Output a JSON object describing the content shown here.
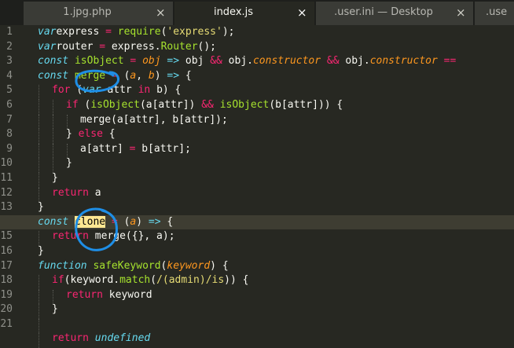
{
  "tabs": [
    {
      "label": "1.jpg.php",
      "close": "×",
      "active": false
    },
    {
      "label": "index.js",
      "close": "×",
      "active": true
    },
    {
      "label": ".user.ini — Desktop",
      "close": "×",
      "active": false
    },
    {
      "label": ".use",
      "close": "",
      "active": false
    }
  ],
  "editor": {
    "current_line": 14,
    "line_numbers": [
      "1",
      "2",
      "3",
      "4",
      "5",
      "6",
      "7",
      "8",
      "9",
      "10",
      "11",
      "12",
      "13",
      "14",
      "15",
      "16",
      "17",
      "18",
      "19",
      "20",
      "21"
    ],
    "annotation_color": "#1e8ee6",
    "lines": [
      [
        [
          "st",
          "var"
        ],
        [
          "",
          "express "
        ],
        [
          "kw",
          "="
        ],
        [
          "",
          " "
        ],
        [
          "fn",
          "require"
        ],
        [
          "",
          "("
        ],
        [
          "str",
          "'express'"
        ],
        [
          "",
          ");"
        ]
      ],
      [
        [
          "st",
          "var"
        ],
        [
          "",
          "router "
        ],
        [
          "kw",
          "="
        ],
        [
          "",
          " express."
        ],
        [
          "fn",
          "Router"
        ],
        [
          "",
          "();"
        ]
      ],
      [
        [
          "st",
          "const"
        ],
        [
          "",
          " "
        ],
        [
          "fn",
          "isObject"
        ],
        [
          "",
          " "
        ],
        [
          "kw",
          "="
        ],
        [
          "",
          " "
        ],
        [
          "var",
          "obj"
        ],
        [
          "",
          " "
        ],
        [
          "st",
          "=>"
        ],
        [
          "",
          " obj "
        ],
        [
          "kw",
          "&&"
        ],
        [
          "",
          " obj."
        ],
        [
          "var",
          "constructor"
        ],
        [
          "",
          " "
        ],
        [
          "kw",
          "&&"
        ],
        [
          "",
          " obj."
        ],
        [
          "var",
          "constructor"
        ],
        [
          "",
          " "
        ],
        [
          "kw",
          "=="
        ]
      ],
      [
        [
          "st",
          "const"
        ],
        [
          "",
          " "
        ],
        [
          "fn",
          "merge"
        ],
        [
          "",
          " "
        ],
        [
          "kw",
          "="
        ],
        [
          "",
          " ("
        ],
        [
          "var",
          "a"
        ],
        [
          "",
          ", "
        ],
        [
          "var",
          "b"
        ],
        [
          "",
          ") "
        ],
        [
          "st",
          "=>"
        ],
        [
          "",
          " {"
        ]
      ],
      [
        [
          "g",
          ""
        ],
        [
          "kw",
          "for"
        ],
        [
          "",
          " ("
        ],
        [
          "st",
          "var"
        ],
        [
          "",
          " attr "
        ],
        [
          "kw",
          "in"
        ],
        [
          "",
          " b) {"
        ]
      ],
      [
        [
          "g",
          ""
        ],
        [
          "g",
          ""
        ],
        [
          "kw",
          "if"
        ],
        [
          "",
          " ("
        ],
        [
          "fn",
          "isObject"
        ],
        [
          "",
          "(a[attr]) "
        ],
        [
          "kw",
          "&&"
        ],
        [
          "",
          " "
        ],
        [
          "fn",
          "isObject"
        ],
        [
          "",
          "(b[attr])) {"
        ]
      ],
      [
        [
          "g",
          ""
        ],
        [
          "g",
          ""
        ],
        [
          "g",
          ""
        ],
        [
          "",
          "merge(a[attr], b[attr]);"
        ]
      ],
      [
        [
          "g",
          ""
        ],
        [
          "g",
          ""
        ],
        [
          "",
          "} "
        ],
        [
          "kw",
          "else"
        ],
        [
          "",
          " {"
        ]
      ],
      [
        [
          "g",
          ""
        ],
        [
          "g",
          ""
        ],
        [
          "g",
          ""
        ],
        [
          "",
          "a[attr] "
        ],
        [
          "kw",
          "="
        ],
        [
          "",
          " b[attr];"
        ]
      ],
      [
        [
          "g",
          ""
        ],
        [
          "g",
          ""
        ],
        [
          "",
          "}"
        ]
      ],
      [
        [
          "g",
          ""
        ],
        [
          "",
          "}"
        ]
      ],
      [
        [
          "g",
          ""
        ],
        [
          "kw",
          "return"
        ],
        [
          "",
          " a"
        ]
      ],
      [
        [
          "",
          "}"
        ]
      ],
      [
        [
          "st",
          "const"
        ],
        [
          "",
          " "
        ],
        [
          "hl",
          "clone"
        ],
        [
          "",
          " "
        ],
        [
          "kw",
          "="
        ],
        [
          "",
          " ("
        ],
        [
          "var",
          "a"
        ],
        [
          "",
          ") "
        ],
        [
          "st",
          "=>"
        ],
        [
          "",
          " {"
        ]
      ],
      [
        [
          "g",
          ""
        ],
        [
          "kw",
          "return"
        ],
        [
          "",
          " merge({}, a);"
        ]
      ],
      [
        [
          "",
          "}"
        ]
      ],
      [
        [
          "st",
          "function"
        ],
        [
          "",
          " "
        ],
        [
          "fn",
          "safeKeyword"
        ],
        [
          "",
          "("
        ],
        [
          "var",
          "keyword"
        ],
        [
          "",
          ") {"
        ]
      ],
      [
        [
          "g",
          ""
        ],
        [
          "kw",
          "if"
        ],
        [
          "",
          "(keyword."
        ],
        [
          "fn",
          "match"
        ],
        [
          "",
          "("
        ],
        [
          "str",
          "/(admin)/is"
        ],
        [
          "",
          ")) {"
        ]
      ],
      [
        [
          "g",
          ""
        ],
        [
          "g",
          ""
        ],
        [
          "kw",
          "return"
        ],
        [
          "",
          " keyword"
        ]
      ],
      [
        [
          "g",
          ""
        ],
        [
          "",
          "}"
        ]
      ],
      [
        [
          "g",
          ""
        ]
      ],
      [
        [
          "g",
          ""
        ],
        [
          "kw",
          "return"
        ],
        [
          "",
          " "
        ],
        [
          "st",
          "undefined"
        ]
      ]
    ]
  }
}
